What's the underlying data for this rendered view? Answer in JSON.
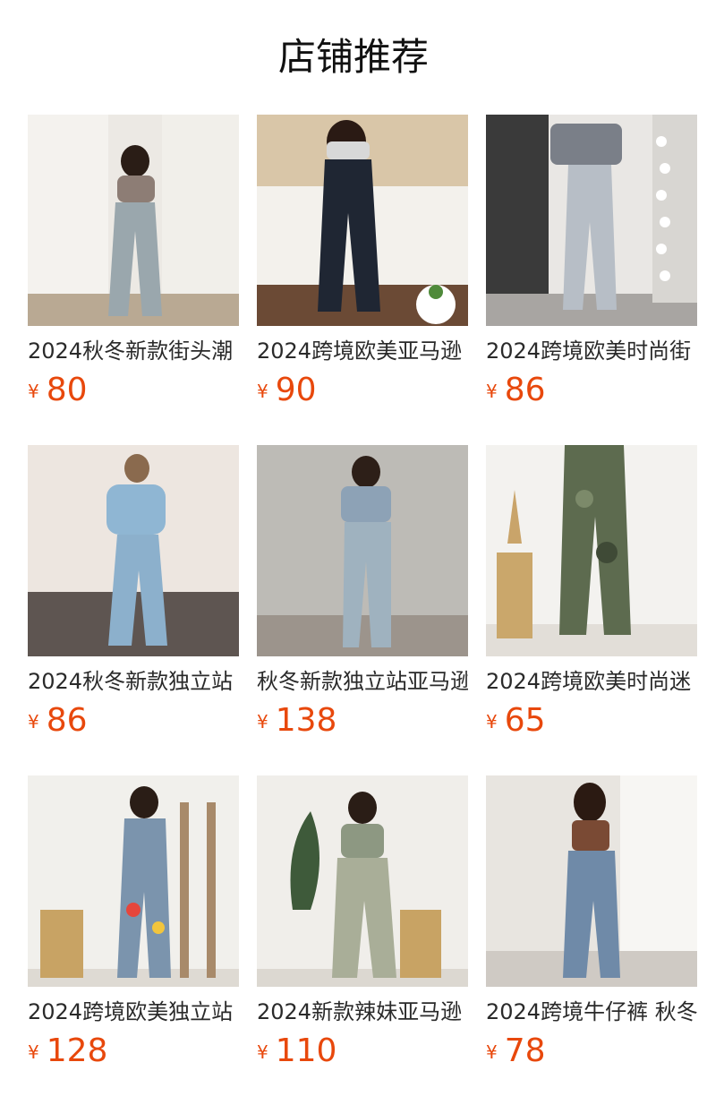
{
  "page": {
    "title": "店铺推荐"
  },
  "currency_symbol": "¥",
  "products": [
    {
      "name": "2024秋冬新款街头潮",
      "price": "80"
    },
    {
      "name": "2024跨境欧美亚马逊",
      "price": "90"
    },
    {
      "name": "2024跨境欧美时尚街",
      "price": "86"
    },
    {
      "name": "2024秋冬新款独立站",
      "price": "86"
    },
    {
      "name": "秋冬新款独立站亚马逊",
      "price": "138"
    },
    {
      "name": "2024跨境欧美时尚迷",
      "price": "65"
    },
    {
      "name": "2024跨境欧美独立站",
      "price": "128"
    },
    {
      "name": "2024新款辣妹亚马逊",
      "price": "110"
    },
    {
      "name": "2024跨境牛仔裤 秋冬",
      "price": "78"
    }
  ]
}
